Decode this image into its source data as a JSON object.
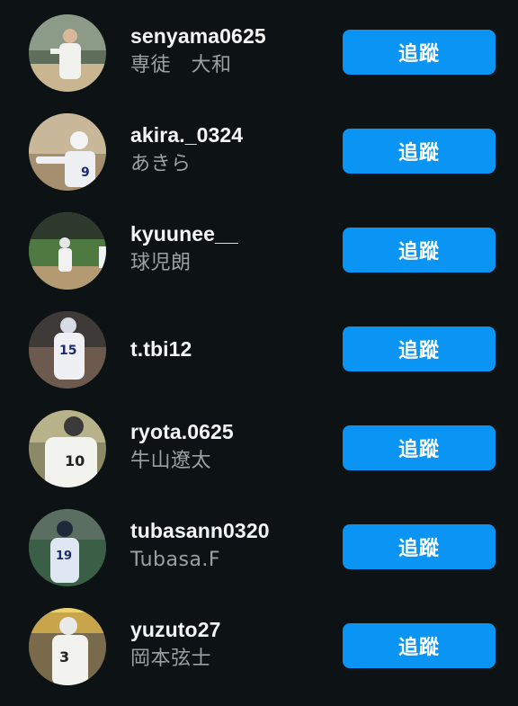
{
  "follow_label": "追蹤",
  "accent_color": "#0a95f4",
  "users": [
    {
      "username": "senyama0625",
      "fullname": "専徒　大和",
      "avatar": "player-avatar"
    },
    {
      "username": "akira._0324",
      "fullname": "あきら",
      "avatar": "player-avatar"
    },
    {
      "username": "kyuunee__",
      "fullname": "球児朗",
      "avatar": "player-avatar"
    },
    {
      "username": "t.tbi12",
      "fullname": "",
      "avatar": "player-avatar"
    },
    {
      "username": "ryota.0625",
      "fullname": "牛山遼太",
      "avatar": "player-avatar"
    },
    {
      "username": "tubasann0320",
      "fullname": "Tubasa.F",
      "avatar": "player-avatar"
    },
    {
      "username": "yuzuto27",
      "fullname": "岡本弦士",
      "avatar": "player-avatar"
    }
  ]
}
